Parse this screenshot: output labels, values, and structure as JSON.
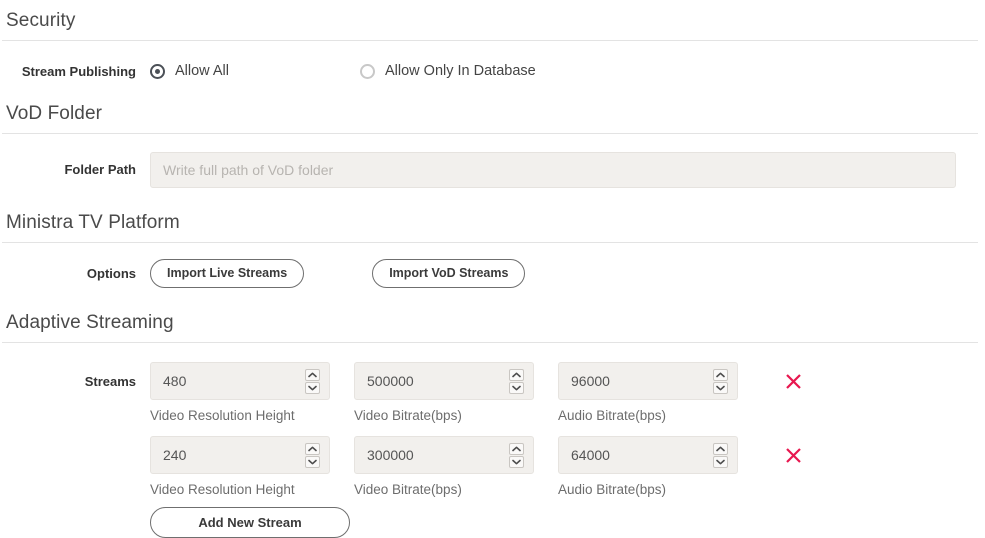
{
  "sections": {
    "security": {
      "title": "Security",
      "stream_publishing": {
        "label": "Stream Publishing",
        "options": [
          {
            "label": "Allow All",
            "selected": true
          },
          {
            "label": "Allow Only In Database",
            "selected": false
          }
        ]
      }
    },
    "vod_folder": {
      "title": "VoD Folder",
      "folder_path": {
        "label": "Folder Path",
        "value": "",
        "placeholder": "Write full path of VoD folder"
      }
    },
    "ministra": {
      "title": "Ministra TV Platform",
      "options_label": "Options",
      "buttons": [
        {
          "label": "Import Live Streams"
        },
        {
          "label": "Import VoD Streams"
        }
      ]
    },
    "adaptive_streaming": {
      "title": "Adaptive Streaming",
      "streams_label": "Streams",
      "captions": {
        "video_resolution_height": "Video Resolution Height",
        "video_bitrate": "Video Bitrate(bps)",
        "audio_bitrate": "Audio Bitrate(bps)"
      },
      "rows": [
        {
          "video_resolution_height": "480",
          "video_bitrate": "500000",
          "audio_bitrate": "96000"
        },
        {
          "video_resolution_height": "240",
          "video_bitrate": "300000",
          "audio_bitrate": "64000"
        }
      ],
      "add_button_label": "Add New Stream"
    }
  },
  "icons": {
    "delete": "close-x-icon",
    "spinner_up": "chevron-up-icon",
    "spinner_down": "chevron-down-icon"
  },
  "colors": {
    "delete_x": "#e8174f",
    "radio_selected": "#4b5057",
    "input_bg": "#f2f0ed",
    "rule": "#e3e3e3",
    "heading": "#4a4a4a"
  }
}
